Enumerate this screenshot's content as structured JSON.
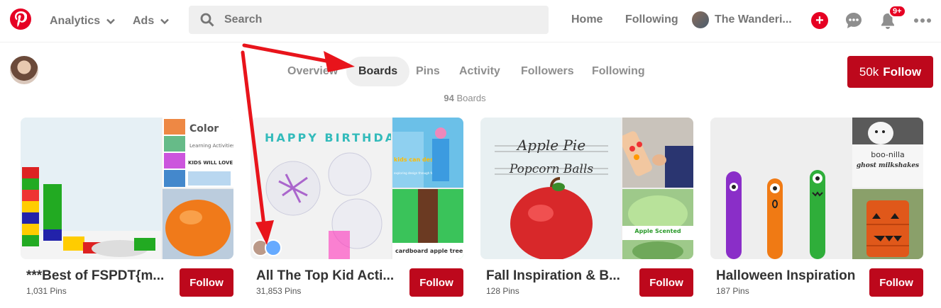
{
  "topbar": {
    "analytics_label": "Analytics",
    "ads_label": "Ads",
    "search_placeholder": "Search",
    "home_label": "Home",
    "following_label": "Following",
    "profile_name": "The Wanderi...",
    "notifications_badge": "9+"
  },
  "profile": {
    "tabs": [
      "Overview",
      "Boards",
      "Pins",
      "Activity",
      "Followers",
      "Following"
    ],
    "active_tab": "Boards",
    "boards_count_num": "94",
    "boards_count_label": " Boards",
    "follow_count": "50k",
    "follow_label": "Follow"
  },
  "boards": [
    {
      "title": "***Best of FSPDT{m...",
      "pins": "1,031 Pins",
      "follow": "Follow"
    },
    {
      "title": "All The Top Kid Acti...",
      "pins": "31,853 Pins",
      "follow": "Follow"
    },
    {
      "title": "Fall Inspiration & B...",
      "pins": "128 Pins",
      "follow": "Follow"
    },
    {
      "title": "Halloween Inspiration",
      "pins": "187 Pins",
      "follow": "Follow"
    }
  ],
  "cover_texts": {
    "b1_sm1_a": "Color",
    "b1_sm1_b": "Learning Activities",
    "b1_sm1_c": "KIDS WILL LOVE",
    "b2_big": "HAPPY BIRTHDAY",
    "b2_sm1": "kids can design!",
    "b2_sm1_b": "exploring design through fort building",
    "b2_sm2": "cardboard apple tree",
    "b3_big_a": "Apple Pie",
    "b3_big_b": "Popcorn Balls",
    "b3_sm2": "Apple Scented",
    "b4_sm1_a": "boo-nilla",
    "b4_sm1_b": "ghost milkshakes"
  },
  "colors": {
    "brand_red": "#e60023",
    "follow_red": "#bd081c",
    "annotation_red": "#e8141b"
  }
}
